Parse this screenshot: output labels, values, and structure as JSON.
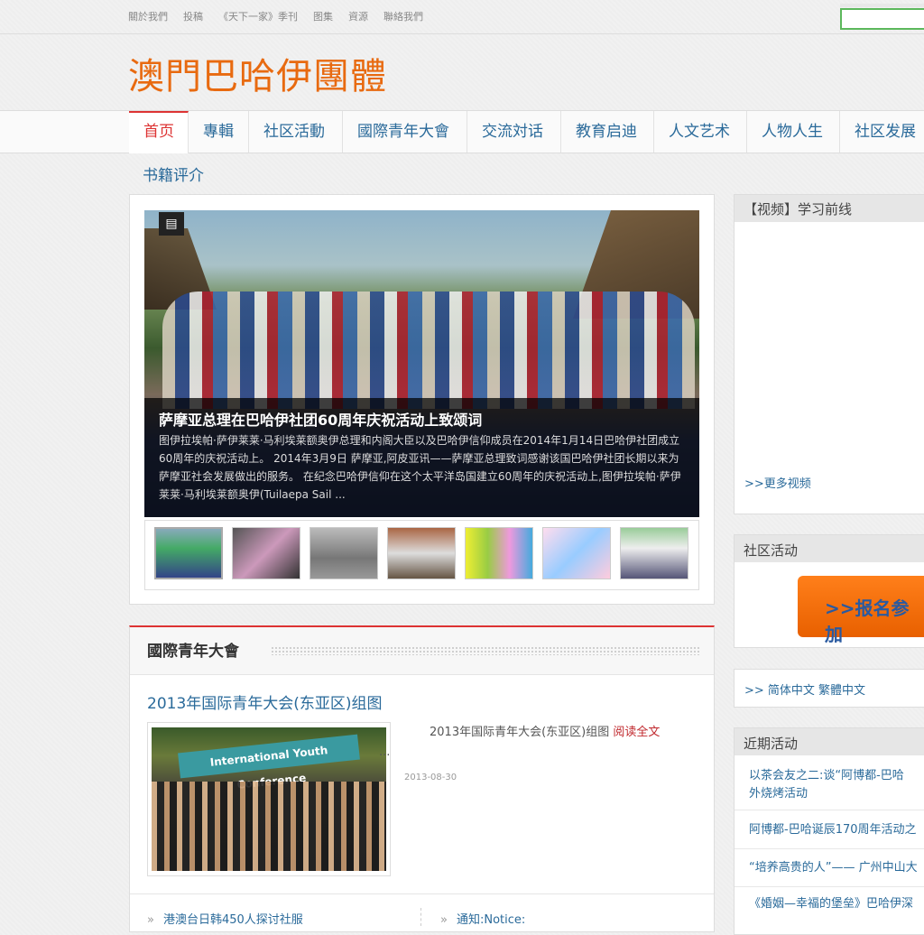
{
  "top_links": [
    "關於我們",
    "投稿",
    "《天下一家》季刊",
    "图集",
    "資源",
    "聯絡我們"
  ],
  "site_title": "澳門巴哈伊團體",
  "nav": [
    "首页",
    "專輯",
    "社区活動",
    "國際青年大會",
    "交流対话",
    "教育启迪",
    "人文艺术",
    "人物人生",
    "社区发展"
  ],
  "nav_row2": "书籍评介",
  "slider": {
    "title": "萨摩亚总理在巴哈伊社团60周年庆祝活动上致颂词",
    "text": "图伊拉埃帕·萨伊莱莱·马利埃莱额奥伊总理和内阁大臣以及巴哈伊信仰成员在2014年1月14日巴哈伊社团成立60周年的庆祝活动上。 2014年3月9日 萨摩亚,阿皮亚讯——萨摩亚总理致词感谢该国巴哈伊社团长期以来为萨摩亚社会发展做出的服务。 在纪念巴哈伊信仰在这个太平洋岛国建立60周年的庆祝活动上,图伊拉埃帕·萨伊莱莱·马利埃莱额奥伊(Tuilaepa Sail ..."
  },
  "section": {
    "title": "國際青年大會",
    "article_title": "2013年国际青年大会(东亚区)组图",
    "article_desc": "2013年国际青年大会(东亚区)组图",
    "read_more": "阅读全文",
    "ellipsis": "...",
    "date": "2013-08-30",
    "image_banner": "International Youth Conference",
    "list": [
      "港澳台日韩450人探讨社服",
      "通知:Notice:"
    ]
  },
  "sidebar": {
    "video_title": "【视频】学习前线",
    "more_video": ">>更多视频",
    "community_title": "社区活动",
    "signup": ">>报名参加",
    "lang_links": ">> 简体中文 繁體中文",
    "recent_title": "近期活动",
    "recent": [
      "以茶会友之二:谈“阿博都-巴哈",
      "外烧烤活动",
      "阿博都-巴哈诞辰170周年活动之",
      "“培养高贵的人”—— 广州中山大",
      "《婚姻—幸福的堡垒》巴哈伊深"
    ]
  },
  "colors": {
    "accent": "#d33333",
    "title": "#e86a10",
    "link": "#2a6a9a"
  }
}
